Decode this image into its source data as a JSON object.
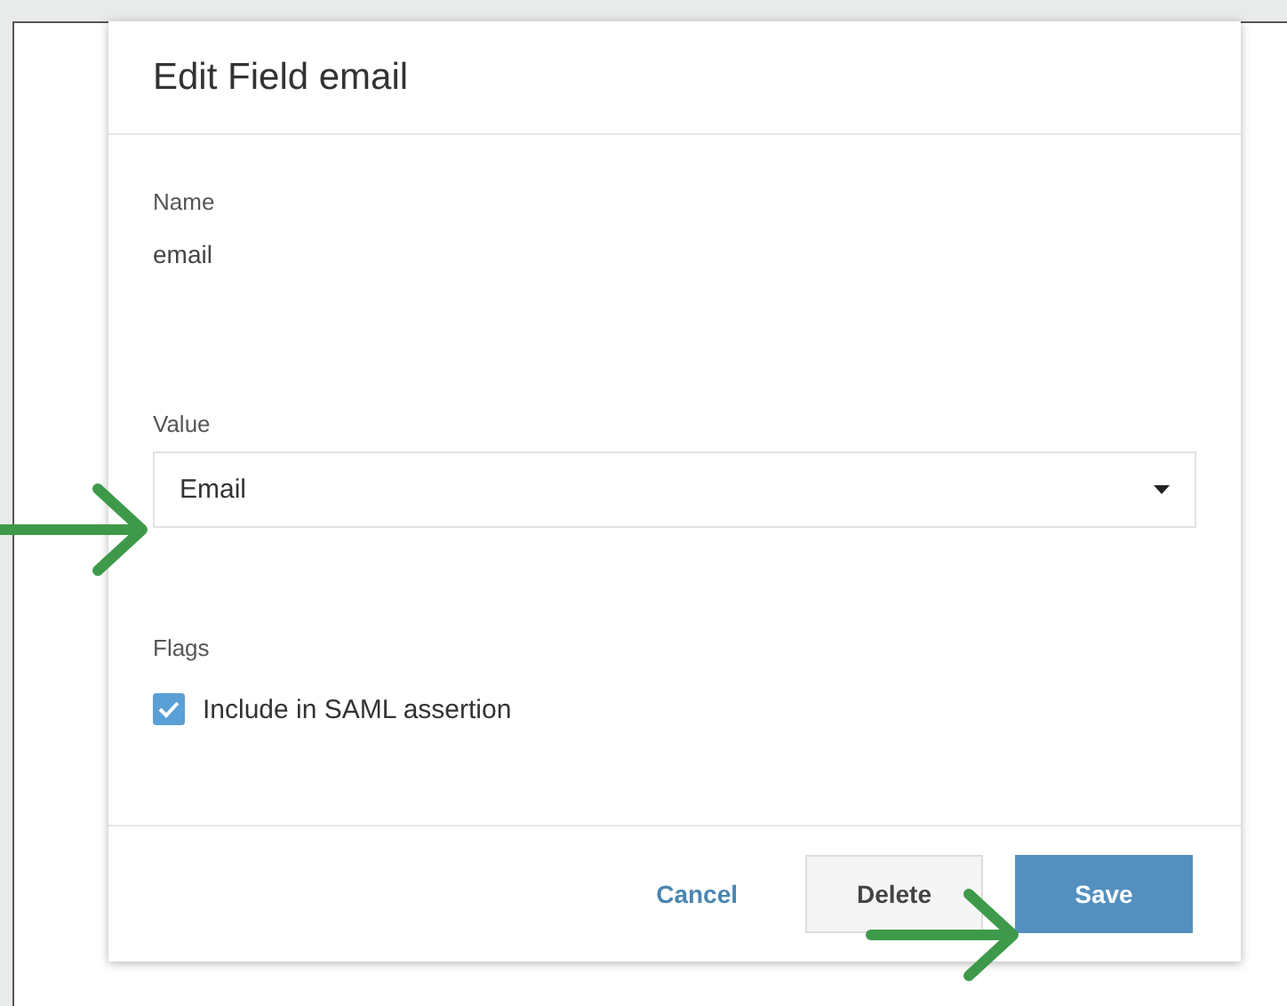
{
  "dialog": {
    "title": "Edit Field email"
  },
  "name_field": {
    "label": "Name",
    "value": "email"
  },
  "value_field": {
    "label": "Value",
    "value": "Email"
  },
  "flags": {
    "label": "Flags",
    "options": [
      {
        "label": "Include in SAML assertion",
        "checked": true
      }
    ]
  },
  "buttons": [
    {
      "label": "Cancel",
      "kind": "link"
    },
    {
      "label": "Delete",
      "kind": "secondary"
    },
    {
      "label": "Save",
      "kind": "primary"
    }
  ]
}
